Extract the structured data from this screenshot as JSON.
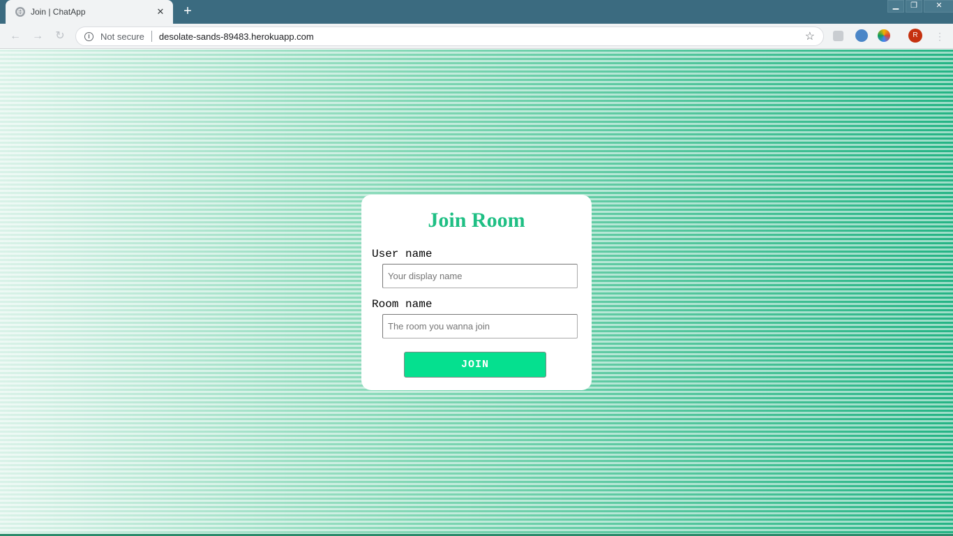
{
  "browser": {
    "tab_title": "Join | ChatApp",
    "tab_close": "✕",
    "new_tab": "+",
    "security_label": "Not secure",
    "url": "desolate-sands-89483.herokuapp.com",
    "profile_initial": "R",
    "window_controls": {
      "minimize": "▁",
      "restore": "❐",
      "close": "✕"
    }
  },
  "page": {
    "title": "Join Room",
    "username": {
      "label": "User name",
      "placeholder": "Your display name",
      "value": ""
    },
    "room": {
      "label": "Room name",
      "placeholder": "The room you wanna join",
      "value": ""
    },
    "join_button": "JOIN"
  },
  "theme": {
    "accent": "#1fbf84",
    "button": "#05e08f",
    "background_start": "#d9f2e8",
    "background_end": "#25b485"
  },
  "icons": [
    "globe-icon",
    "close-icon",
    "plus-icon",
    "back-icon",
    "forward-icon",
    "reload-icon",
    "info-icon",
    "star-icon",
    "extension-icon",
    "sync-icon",
    "color-picker-icon",
    "avatar",
    "menu-icon"
  ]
}
